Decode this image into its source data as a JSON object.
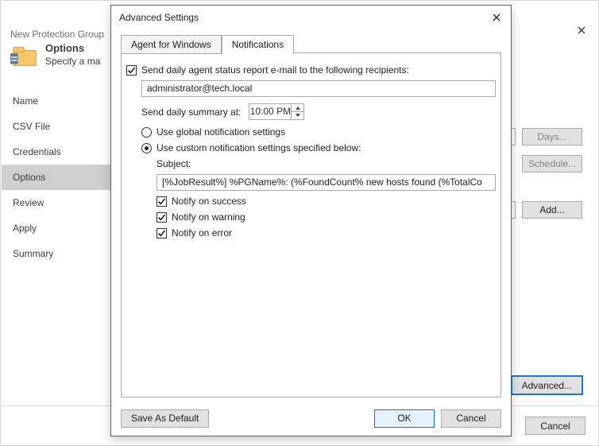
{
  "wizard": {
    "title": "New Protection Group",
    "heading": "Options",
    "subheading": "Specify a ma",
    "nav": [
      "Name",
      "CSV File",
      "Credentials",
      "Options",
      "Review",
      "Apply",
      "Summary"
    ],
    "nav_active_index": 3,
    "buttons": {
      "days": "Days...",
      "schedule": "Schedule...",
      "add": "Add...",
      "advanced": "Advanced...",
      "cancel": "Cancel"
    }
  },
  "modal": {
    "title": "Advanced Settings",
    "tabs": {
      "t1": "Agent for Windows",
      "t2": "Notifications",
      "active": 1
    },
    "send_daily_label": "Send daily agent status report e-mail to the following recipients:",
    "send_daily_checked": true,
    "recipients": "administrator@tech.local",
    "summary_at_label": "Send daily summary at:",
    "summary_time": "10:00 PM",
    "radio": {
      "global": "Use global notification settings",
      "custom": "Use custom notification settings specified below:",
      "selected": "custom"
    },
    "subject_label": "Subject:",
    "subject_value": "[%JobResult%] %PGName%: (%FoundCount% new hosts found (%TotalCo",
    "notify": {
      "success": {
        "label": "Notify on success",
        "checked": true
      },
      "warning": {
        "label": "Notify on warning",
        "checked": true
      },
      "error": {
        "label": "Notify on error",
        "checked": true
      }
    },
    "buttons": {
      "save_default": "Save As Default",
      "ok": "OK",
      "cancel": "Cancel"
    }
  }
}
